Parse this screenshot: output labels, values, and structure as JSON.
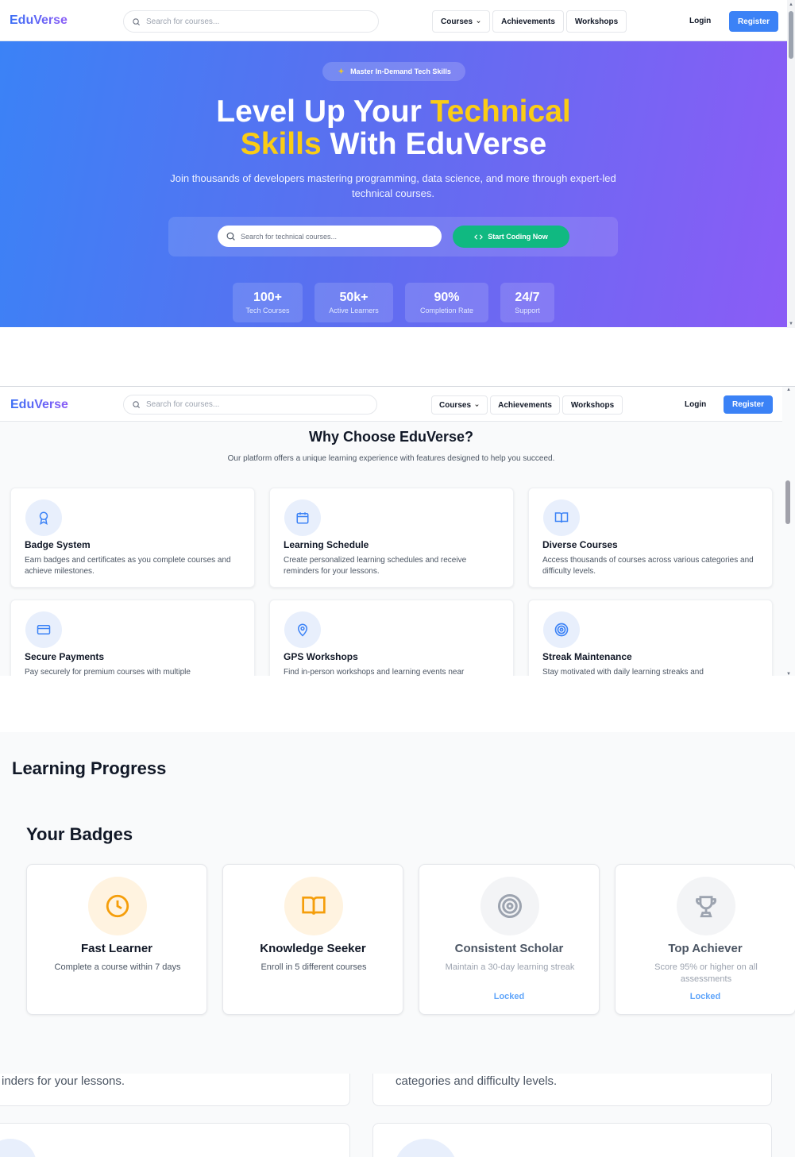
{
  "navbar": {
    "logo": "EduVerse",
    "search_placeholder": "Search for courses...",
    "courses": "Courses",
    "achievements": "Achievements",
    "workshops": "Workshops",
    "login": "Login",
    "register": "Register"
  },
  "hero": {
    "pill": "Master In-Demand Tech Skills",
    "title_part1": "Level Up Your ",
    "title_highlight1": "Technical",
    "title_highlight2": "Skills",
    "title_part2": " With EduVerse",
    "subtitle": "Join thousands of developers mastering programming, data science, and more through expert-led technical courses.",
    "search_placeholder": "Search for technical courses...",
    "cta": "Start Coding Now",
    "stats": [
      {
        "value": "100+",
        "label": "Tech Courses"
      },
      {
        "value": "50k+",
        "label": "Active Learners"
      },
      {
        "value": "90%",
        "label": "Completion Rate"
      },
      {
        "value": "24/7",
        "label": "Support"
      }
    ]
  },
  "features": {
    "title": "Why Choose EduVerse?",
    "subtitle": "Our platform offers a unique learning experience with features designed to help you succeed.",
    "cards": [
      {
        "icon": "award-icon",
        "title": "Badge System",
        "desc": "Earn badges and certificates as you complete courses and achieve milestones."
      },
      {
        "icon": "calendar-icon",
        "title": "Learning Schedule",
        "desc": "Create personalized learning schedules and receive reminders for your lessons."
      },
      {
        "icon": "book-icon",
        "title": "Diverse Courses",
        "desc": "Access thousands of courses across various categories and difficulty levels."
      },
      {
        "icon": "credit-card-icon",
        "title": "Secure Payments",
        "desc": "Pay securely for premium courses with multiple"
      },
      {
        "icon": "map-pin-icon",
        "title": "GPS Workshops",
        "desc": "Find in-person workshops and learning events near"
      },
      {
        "icon": "target-icon",
        "title": "Streak Maintenance",
        "desc": "Stay motivated with daily learning streaks and"
      }
    ]
  },
  "progress": {
    "title": "Learning Progress",
    "badges_title": "Your Badges",
    "badges": [
      {
        "icon": "clock-icon",
        "name": "Fast Learner",
        "desc": "Complete a course within 7 days",
        "status": ""
      },
      {
        "icon": "book-open-icon",
        "name": "Knowledge Seeker",
        "desc": "Enroll in 5 different courses",
        "status": ""
      },
      {
        "icon": "target-icon",
        "name": "Consistent Scholar",
        "desc": "Maintain a 30-day learning streak",
        "status": "Locked"
      },
      {
        "icon": "trophy-icon",
        "name": "Top Achiever",
        "desc": "Score 95% or higher on all assessments",
        "status": "Locked"
      }
    ]
  },
  "zoomed": {
    "left_text": "inders for your lessons.",
    "right_text": "categories and difficulty levels."
  },
  "colors": {
    "brand_blue": "#3b82f6",
    "brand_purple": "#8b5cf6",
    "highlight_yellow": "#facc15",
    "cta_green": "#10b981",
    "badge_warm": "#f59e0b",
    "locked_blue": "#60a5fa"
  }
}
